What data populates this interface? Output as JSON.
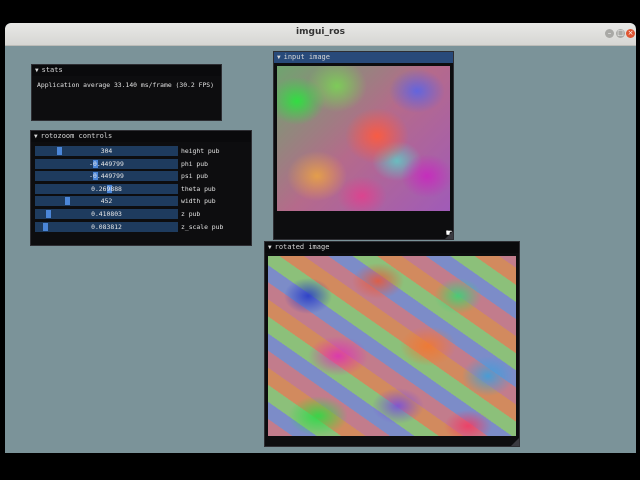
{
  "window": {
    "title": "imgui_ros"
  },
  "stats": {
    "title": "stats",
    "text": "Application average 33.140 ms/frame (30.2 FPS)"
  },
  "rotozoom": {
    "title": "rotozoom controls",
    "sliders": [
      {
        "value": "304",
        "label": "height pub",
        "fraction": 0.16
      },
      {
        "value": "-0.449799",
        "label": "phi pub",
        "fraction": 0.42
      },
      {
        "value": "-0.449799",
        "label": "psi pub",
        "fraction": 0.42
      },
      {
        "value": "0.269888",
        "label": "theta pub",
        "fraction": 0.52
      },
      {
        "value": "452",
        "label": "width pub",
        "fraction": 0.22
      },
      {
        "value": "0.410803",
        "label": "z pub",
        "fraction": 0.08
      },
      {
        "value": "0.083812",
        "label": "z_scale pub",
        "fraction": 0.06
      }
    ]
  },
  "input_image": {
    "title": "input image"
  },
  "rotated_image": {
    "title": "rotated image"
  },
  "icons": {
    "collapse": "triangle-down-icon",
    "close": "close-icon",
    "maximize": "maximize-icon",
    "minimize": "minimize-icon"
  },
  "colors": {
    "background": "#7b9399",
    "slider_track": "#1e3b5e",
    "slider_grab": "#4b86d8",
    "header_active": "#284a7a",
    "close_button": "#e05532"
  }
}
